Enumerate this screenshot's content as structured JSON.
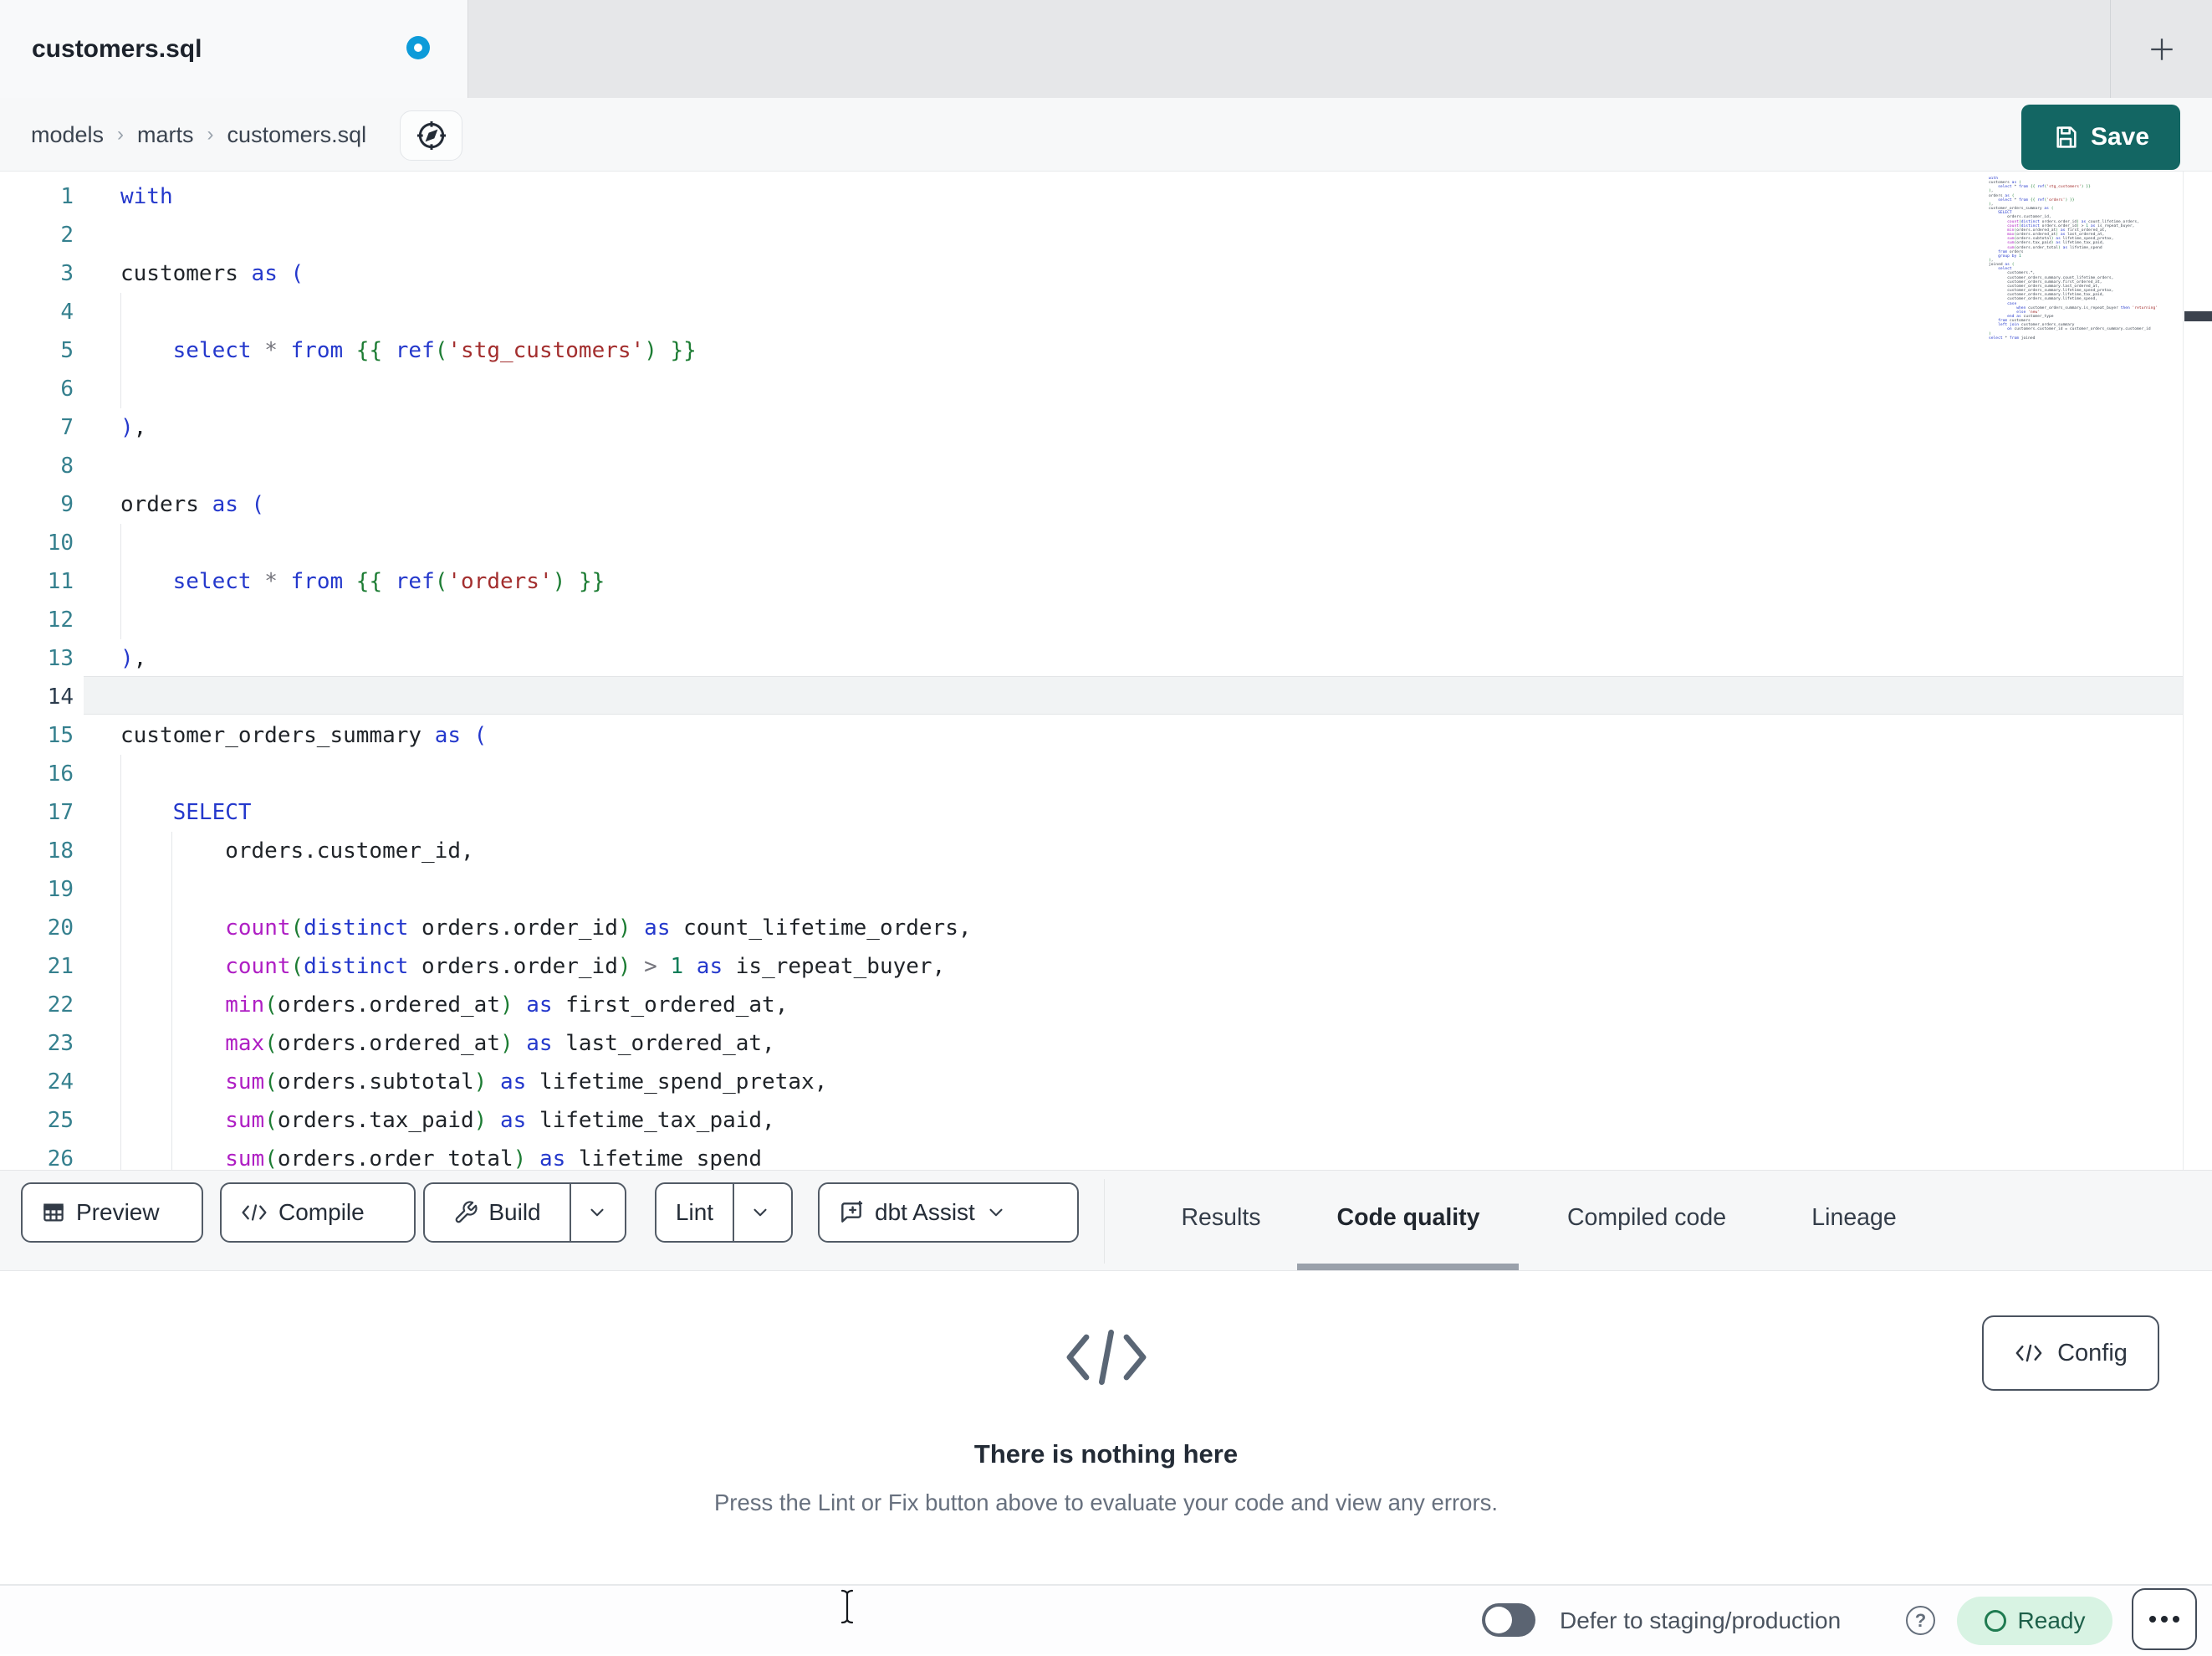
{
  "tab_bar": {
    "title": "customers.sql",
    "new_tab_label": "+"
  },
  "breadcrumb": {
    "items": [
      "models",
      "marts",
      "customers.sql"
    ],
    "separator": "›"
  },
  "save": {
    "label": "Save"
  },
  "editor": {
    "current_line": 14,
    "lines": [
      {
        "n": 1,
        "tokens": [
          [
            "k",
            "with"
          ]
        ]
      },
      {
        "n": 2,
        "tokens": []
      },
      {
        "n": 3,
        "tokens": [
          [
            "t",
            "customers "
          ],
          [
            "k",
            "as"
          ],
          [
            "t",
            " "
          ],
          [
            "k",
            "("
          ]
        ]
      },
      {
        "n": 4,
        "tokens": []
      },
      {
        "n": 5,
        "tokens": [
          [
            "t",
            "    "
          ],
          [
            "k",
            "select"
          ],
          [
            "t",
            " "
          ],
          [
            "o",
            "*"
          ],
          [
            "t",
            " "
          ],
          [
            "k",
            "from"
          ],
          [
            "t",
            " "
          ],
          [
            "g",
            "{{"
          ],
          [
            "t",
            " "
          ],
          [
            "k",
            "ref"
          ],
          [
            "g",
            "("
          ],
          [
            "s",
            "'stg_customers'"
          ],
          [
            "g",
            ")"
          ],
          [
            "t",
            " "
          ],
          [
            "g",
            "}}"
          ]
        ]
      },
      {
        "n": 6,
        "tokens": []
      },
      {
        "n": 7,
        "tokens": [
          [
            "k",
            ")"
          ],
          [
            "t",
            ","
          ]
        ]
      },
      {
        "n": 8,
        "tokens": []
      },
      {
        "n": 9,
        "tokens": [
          [
            "t",
            "orders "
          ],
          [
            "k",
            "as"
          ],
          [
            "t",
            " "
          ],
          [
            "k",
            "("
          ]
        ]
      },
      {
        "n": 10,
        "tokens": []
      },
      {
        "n": 11,
        "tokens": [
          [
            "t",
            "    "
          ],
          [
            "k",
            "select"
          ],
          [
            "t",
            " "
          ],
          [
            "o",
            "*"
          ],
          [
            "t",
            " "
          ],
          [
            "k",
            "from"
          ],
          [
            "t",
            " "
          ],
          [
            "g",
            "{{"
          ],
          [
            "t",
            " "
          ],
          [
            "k",
            "ref"
          ],
          [
            "g",
            "("
          ],
          [
            "s",
            "'orders'"
          ],
          [
            "g",
            ")"
          ],
          [
            "t",
            " "
          ],
          [
            "g",
            "}}"
          ]
        ]
      },
      {
        "n": 12,
        "tokens": []
      },
      {
        "n": 13,
        "tokens": [
          [
            "k",
            ")"
          ],
          [
            "t",
            ","
          ]
        ]
      },
      {
        "n": 14,
        "tokens": []
      },
      {
        "n": 15,
        "tokens": [
          [
            "t",
            "customer_orders_summary "
          ],
          [
            "k",
            "as"
          ],
          [
            "t",
            " "
          ],
          [
            "k",
            "("
          ]
        ]
      },
      {
        "n": 16,
        "tokens": []
      },
      {
        "n": 17,
        "tokens": [
          [
            "t",
            "    "
          ],
          [
            "k",
            "SELECT"
          ]
        ]
      },
      {
        "n": 18,
        "tokens": [
          [
            "t",
            "        orders.customer_id,"
          ]
        ]
      },
      {
        "n": 19,
        "tokens": []
      },
      {
        "n": 20,
        "tokens": [
          [
            "t",
            "        "
          ],
          [
            "f",
            "count"
          ],
          [
            "g",
            "("
          ],
          [
            "k",
            "distinct"
          ],
          [
            "t",
            " orders.order_id"
          ],
          [
            "g",
            ")"
          ],
          [
            "t",
            " "
          ],
          [
            "k",
            "as"
          ],
          [
            "t",
            " count_lifetime_orders,"
          ]
        ]
      },
      {
        "n": 21,
        "tokens": [
          [
            "t",
            "        "
          ],
          [
            "f",
            "count"
          ],
          [
            "g",
            "("
          ],
          [
            "k",
            "distinct"
          ],
          [
            "t",
            " orders.order_id"
          ],
          [
            "g",
            ")"
          ],
          [
            "t",
            " "
          ],
          [
            "o",
            ">"
          ],
          [
            "t",
            " "
          ],
          [
            "n",
            "1"
          ],
          [
            "t",
            " "
          ],
          [
            "k",
            "as"
          ],
          [
            "t",
            " is_repeat_buyer,"
          ]
        ]
      },
      {
        "n": 22,
        "tokens": [
          [
            "t",
            "        "
          ],
          [
            "f",
            "min"
          ],
          [
            "g",
            "("
          ],
          [
            "t",
            "orders.ordered_at"
          ],
          [
            "g",
            ")"
          ],
          [
            "t",
            " "
          ],
          [
            "k",
            "as"
          ],
          [
            "t",
            " first_ordered_at,"
          ]
        ]
      },
      {
        "n": 23,
        "tokens": [
          [
            "t",
            "        "
          ],
          [
            "f",
            "max"
          ],
          [
            "g",
            "("
          ],
          [
            "t",
            "orders.ordered_at"
          ],
          [
            "g",
            ")"
          ],
          [
            "t",
            " "
          ],
          [
            "k",
            "as"
          ],
          [
            "t",
            " last_ordered_at,"
          ]
        ]
      },
      {
        "n": 24,
        "tokens": [
          [
            "t",
            "        "
          ],
          [
            "f",
            "sum"
          ],
          [
            "g",
            "("
          ],
          [
            "t",
            "orders.subtotal"
          ],
          [
            "g",
            ")"
          ],
          [
            "t",
            " "
          ],
          [
            "k",
            "as"
          ],
          [
            "t",
            " lifetime_spend_pretax,"
          ]
        ]
      },
      {
        "n": 25,
        "tokens": [
          [
            "t",
            "        "
          ],
          [
            "f",
            "sum"
          ],
          [
            "g",
            "("
          ],
          [
            "t",
            "orders.tax_paid"
          ],
          [
            "g",
            ")"
          ],
          [
            "t",
            " "
          ],
          [
            "k",
            "as"
          ],
          [
            "t",
            " lifetime_tax_paid,"
          ]
        ]
      },
      {
        "n": 26,
        "tokens": [
          [
            "t",
            "        "
          ],
          [
            "f",
            "sum"
          ],
          [
            "g",
            "("
          ],
          [
            "t",
            "orders.order_total"
          ],
          [
            "g",
            ")"
          ],
          [
            "t",
            " "
          ],
          [
            "k",
            "as"
          ],
          [
            "t",
            " lifetime_spend"
          ]
        ]
      }
    ],
    "minimap_text": "with\ncustomers as (\n    select * from {{ ref('stg_customers') }}\n),\norders as (\n    select * from {{ ref('orders') }}\n),\ncustomer_orders_summary as (\n    SELECT\n        orders.customer_id,\n        count(distinct orders.order_id) as count_lifetime_orders,\n        count(distinct orders.order_id) > 1 as is_repeat_buyer,\n        min(orders.ordered_at) as first_ordered_at,\n        max(orders.ordered_at) as last_ordered_at,\n        sum(orders.subtotal) as lifetime_spend_pretax,\n        sum(orders.tax_paid) as lifetime_tax_paid,\n        sum(orders.order_total) as lifetime_spend\n    from orders\n    group by 1\n),\njoined as (\n    select\n        customers.*,\n        customer_orders_summary.count_lifetime_orders,\n        customer_orders_summary.first_ordered_at,\n        customer_orders_summary.last_ordered_at,\n        customer_orders_summary.lifetime_spend_pretax,\n        customer_orders_summary.lifetime_tax_paid,\n        customer_orders_summary.lifetime_spend,\n        case\n            when customer_orders_summary.is_repeat_buyer then 'returning'\n            else 'new'\n        end as customer_type\n    from customers\n    left join customer_orders_summary\n        on customers.customer_id = customer_orders_summary.customer_id\n)\nselect * from joined"
  },
  "toolbar": {
    "preview_label": "Preview",
    "compile_label": "Compile",
    "build_label": "Build",
    "lint_label": "Lint",
    "dbt_assist_label": "dbt Assist"
  },
  "results_tabs": {
    "items": [
      {
        "label": "Results",
        "active": false
      },
      {
        "label": "Code quality",
        "active": true
      },
      {
        "label": "Compiled code",
        "active": false
      },
      {
        "label": "Lineage",
        "active": false
      }
    ]
  },
  "results_panel": {
    "empty_title": "There is nothing here",
    "empty_subtitle": "Press the Lint or Fix button above to evaluate your code and view any errors.",
    "config_label": "Config"
  },
  "status_bar": {
    "defer_label": "Defer to staging/production",
    "help_glyph": "?",
    "ready_label": "Ready"
  },
  "colors": {
    "accent_teal": "#136663",
    "unsaved_dot_blue": "#0d9bd9",
    "ready_bg": "#d8f3e3",
    "ready_green": "#1f7b51",
    "ready_text": "#1d5f49",
    "syntax_keyword": "#2438cc",
    "syntax_function": "#af1fc4",
    "syntax_string": "#a32e2e",
    "syntax_number": "#0e7d58",
    "syntax_bracket": "#1c7c33",
    "line_number_teal": "#35808e",
    "tab_underline_gray": "#9aa1ab"
  }
}
